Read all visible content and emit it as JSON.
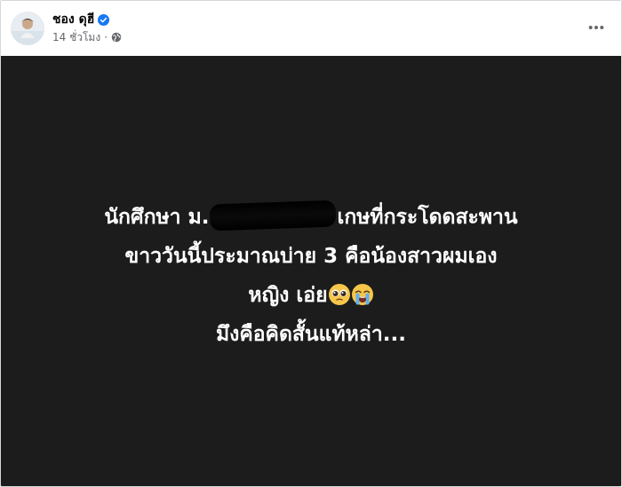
{
  "post": {
    "author_name": "ชอง ดุฮี",
    "time": "14 ชั่วโมง",
    "separator": "·",
    "privacy_icon": "globe-icon",
    "verified_icon": "verified-badge-icon",
    "more_icon": "more-horizontal-icon",
    "background_color": "#1c1c1c",
    "text_color": "#ffffff",
    "lines": [
      {
        "before": "นักศึกษา ม.",
        "after": "เกษที่กระโดดสะพาน"
      },
      {
        "text": "ขาววันนี้ประมาณบ่าย 3 คือน้องสาวผมเอง"
      },
      {
        "text": "หญิง เอ่ย"
      },
      {
        "text": "มึงคือคิดสั้นแท้หล่า..."
      }
    ],
    "emojis": [
      "pleading-face-icon",
      "loudly-crying-face-icon"
    ]
  }
}
